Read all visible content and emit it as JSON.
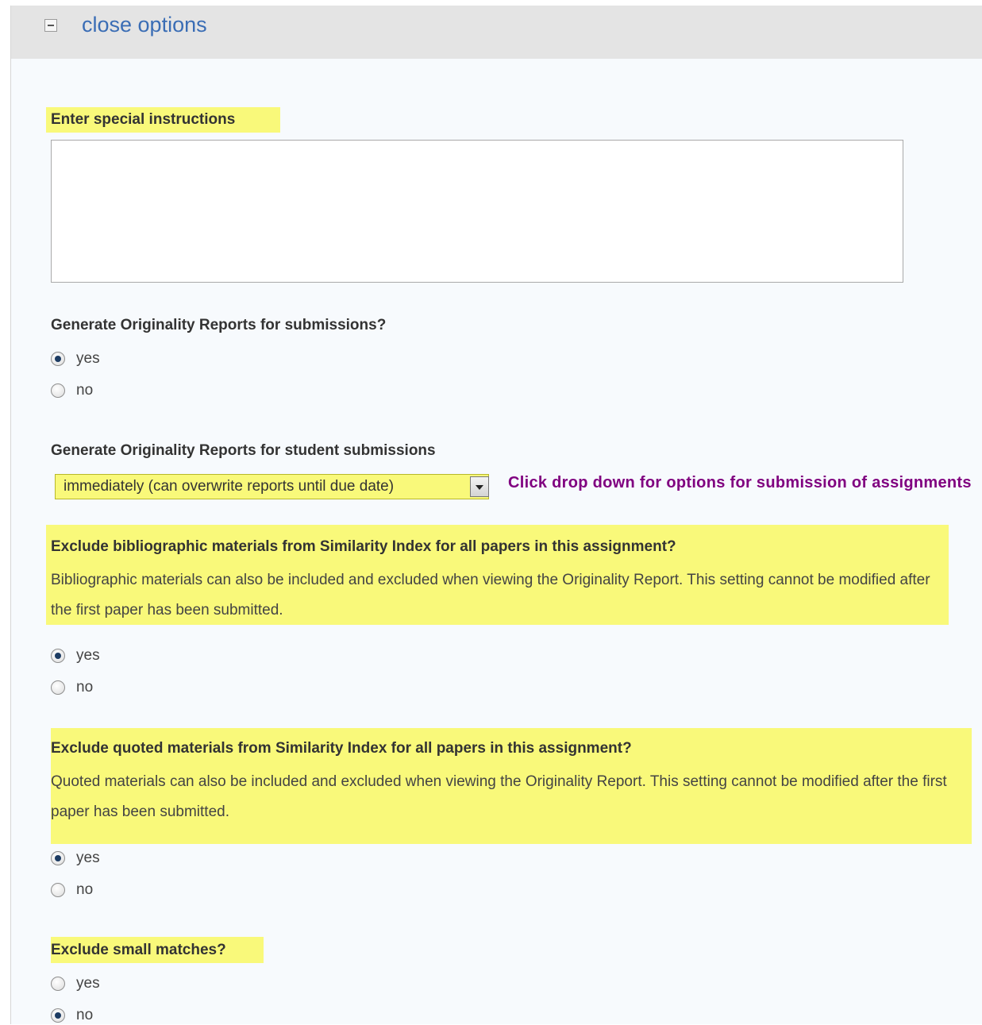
{
  "header": {
    "close_label": "close options"
  },
  "special_instructions": {
    "label": "Enter special instructions",
    "value": ""
  },
  "originality_reports": {
    "question": "Generate Originality Reports for submissions?",
    "options": [
      {
        "label": "yes",
        "checked": true
      },
      {
        "label": "no",
        "checked": false
      }
    ]
  },
  "report_timing": {
    "label": "Generate Originality Reports for student submissions",
    "selected": "immediately (can overwrite reports until due date)",
    "note": "Click drop down for options for submission of assignments"
  },
  "exclude_bibliographic": {
    "question": "Exclude bibliographic materials from Similarity Index for all papers in this assignment?",
    "description": "Bibliographic materials can also be included and excluded when viewing the Originality Report. This setting cannot be modified after the first paper has been submitted.",
    "options": [
      {
        "label": "yes",
        "checked": true
      },
      {
        "label": "no",
        "checked": false
      }
    ]
  },
  "exclude_quoted": {
    "question": "Exclude quoted materials from Similarity Index for all papers in this assignment?",
    "description": "Quoted materials can also be included and excluded when viewing the Originality Report. This setting cannot be modified after the first paper has been submitted.",
    "options": [
      {
        "label": "yes",
        "checked": true
      },
      {
        "label": "no",
        "checked": false
      }
    ]
  },
  "exclude_small_matches": {
    "question": "Exclude small matches?",
    "options": [
      {
        "label": "yes",
        "checked": false
      },
      {
        "label": "no",
        "checked": true
      }
    ]
  },
  "colors": {
    "highlight": "#f9f97a",
    "link": "#3a6db5",
    "note": "#800080"
  }
}
